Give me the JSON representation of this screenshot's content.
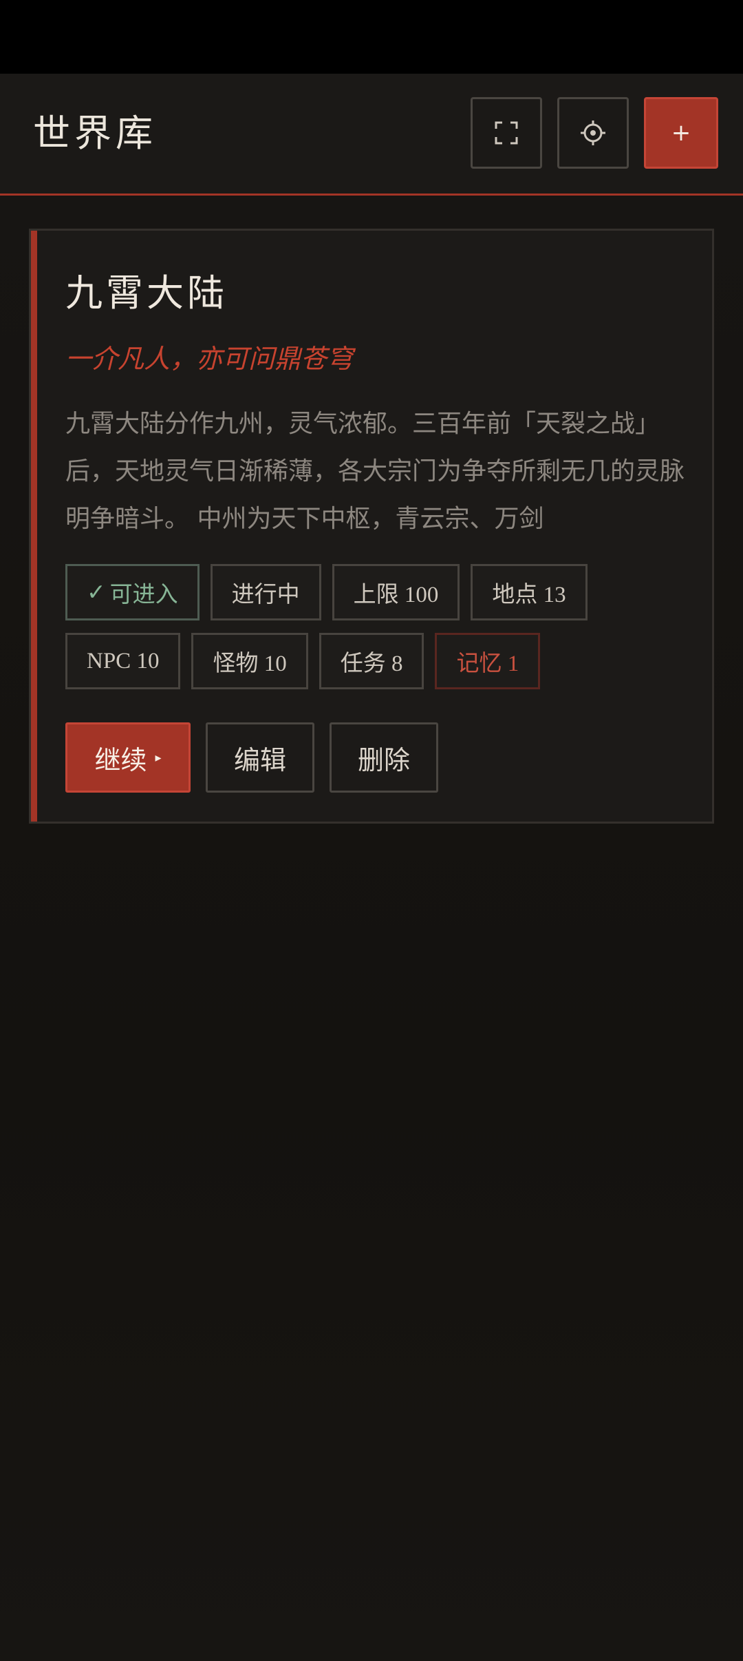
{
  "header": {
    "title": "世界库",
    "fullscreen_icon": "fullscreen-icon",
    "settings_icon": "settings-icon",
    "add_label": "+"
  },
  "world": {
    "title": "九霄大陆",
    "subtitle": "一介凡人，亦可问鼎苍穹",
    "description": "九霄大陆分作九州，灵气浓郁。三百年前「天裂之战」后，天地灵气日渐稀薄，各大宗门为争夺所剩无几的灵脉明争暗斗。 中州为天下中枢，青云宗、万剑",
    "tags": {
      "enterable": "可进入",
      "enterable_icon": "✓",
      "in_progress": "进行中",
      "limit": "上限 100",
      "locations": "地点 13",
      "npc": "NPC 10",
      "monsters": "怪物 10",
      "quests": "任务 8",
      "memory": "记忆 1"
    },
    "actions": {
      "continue": "继续",
      "continue_caret": "▸",
      "edit": "编辑",
      "delete": "删除"
    }
  },
  "colors": {
    "accent": "#a33426",
    "background": "#141210",
    "card": "#1c1a18",
    "ok_green": "#87b596",
    "memory_red": "#c9513f"
  }
}
